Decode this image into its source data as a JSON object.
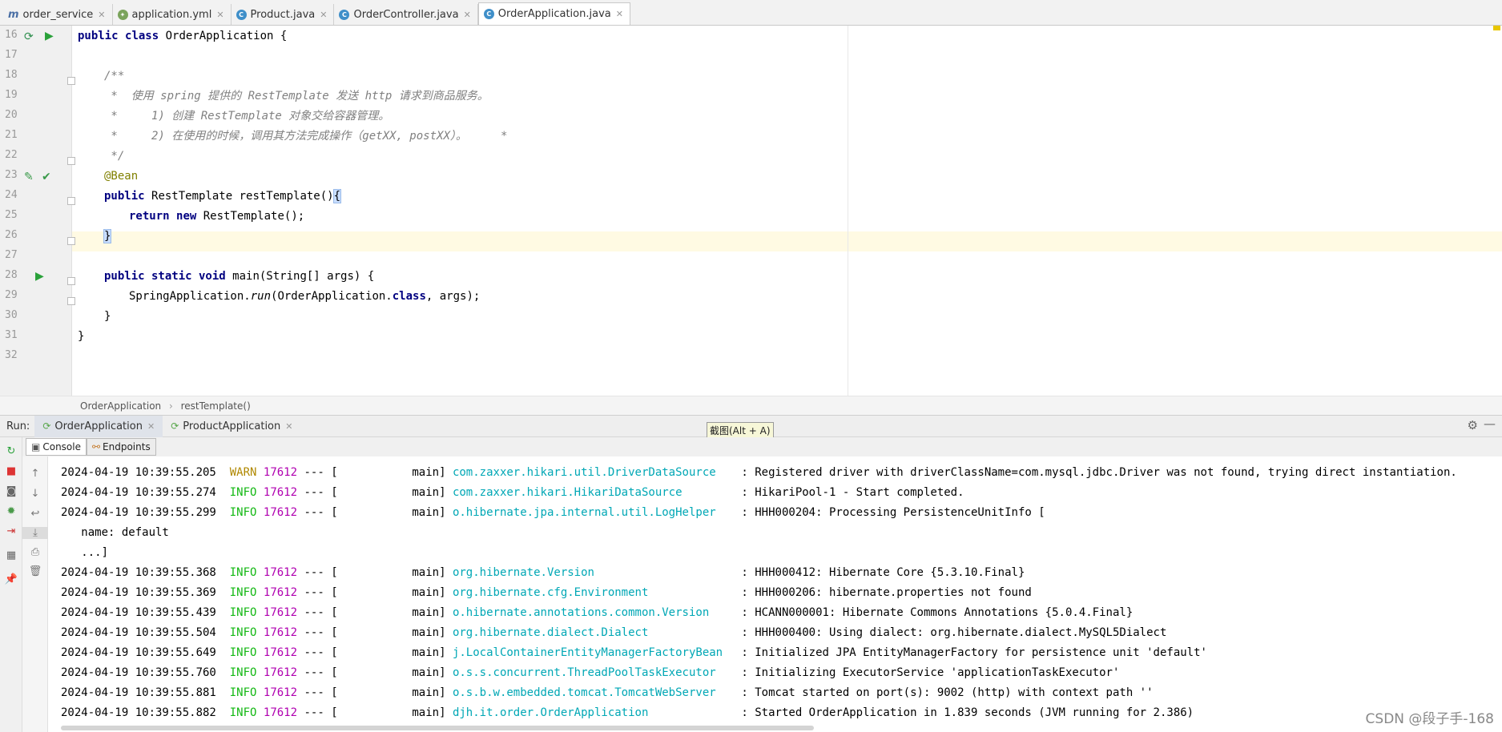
{
  "tabs": [
    {
      "label": "order_service",
      "icon": "module-icon",
      "active": false
    },
    {
      "label": "application.yml",
      "icon": "yaml-icon",
      "active": false
    },
    {
      "label": "Product.java",
      "icon": "class-icon",
      "active": false
    },
    {
      "label": "OrderController.java",
      "icon": "class-icon",
      "active": false
    },
    {
      "label": "OrderApplication.java",
      "icon": "class-icon",
      "active": true
    }
  ],
  "editor": {
    "line_numbers": [
      "16",
      "17",
      "18",
      "19",
      "20",
      "21",
      "22",
      "23",
      "24",
      "25",
      "26",
      "27",
      "28",
      "29",
      "30",
      "31",
      "32"
    ],
    "current_line": "26",
    "code": {
      "l16_kw1": "public",
      "l16_kw2": "class",
      "l16_rest": "OrderApplication {",
      "l18": "/**",
      "l19_a": " *  使用 ",
      "l19_b": "spring",
      "l19_c": " 提供的 ",
      "l19_d": "RestTemplate",
      "l19_e": " 发送 ",
      "l19_f": "http",
      "l19_g": " 请求到商品服务。",
      "l20_a": " *     1) 创建 ",
      "l20_b": "RestTemplate",
      "l20_c": " 对象交给容器管理。",
      "l21_a": " *     2) 在使用的时候，调用其方法完成操作（",
      "l21_b": "getXX, postXX",
      "l21_c": "）。     *",
      "l22": " */",
      "l23": "@Bean",
      "l24_kw": "public",
      "l24_rest": "RestTemplate restTemplate()",
      "l24_brace": "{",
      "l25_kw1": "return",
      "l25_kw2": "new",
      "l25_rest": "RestTemplate();",
      "l26": "}",
      "l28_kw": "public static void",
      "l28_rest": "main(String[] args) {",
      "l29_a": "SpringApplication.",
      "l29_b": "run",
      "l29_c": "(OrderApplication.",
      "l29_d": "class",
      "l29_e": ", args);",
      "l30": "}",
      "l31": "}"
    }
  },
  "breadcrumb": {
    "item1": "OrderApplication",
    "sep": "›",
    "item2": "restTemplate()"
  },
  "run": {
    "label": "Run:",
    "tabs": [
      {
        "label": "OrderApplication",
        "active": true
      },
      {
        "label": "ProductApplication",
        "active": false
      }
    ],
    "tooltip": "截图(Alt + A)"
  },
  "console_tabs": [
    {
      "label": "Console",
      "active": true
    },
    {
      "label": "Endpoints",
      "active": false
    }
  ],
  "log": [
    {
      "ts": "2024-04-19 10:39:55.205",
      "level": "WARN",
      "pid": "17612",
      "sep": "--- [",
      "thread": "main]",
      "logger": "com.zaxxer.hikari.util.DriverDataSource",
      "msg": ": Registered driver with driverClassName=com.mysql.jdbc.Driver was not found, trying direct instantiation."
    },
    {
      "ts": "2024-04-19 10:39:55.274",
      "level": "INFO",
      "pid": "17612",
      "sep": "--- [",
      "thread": "main]",
      "logger": "com.zaxxer.hikari.HikariDataSource",
      "msg": ": HikariPool-1 - Start completed."
    },
    {
      "ts": "2024-04-19 10:39:55.299",
      "level": "INFO",
      "pid": "17612",
      "sep": "--- [",
      "thread": "main]",
      "logger": "o.hibernate.jpa.internal.util.LogHelper",
      "msg": ": HHH000204: Processing PersistenceUnitInfo ["
    },
    {
      "plain": "   name: default"
    },
    {
      "plain": "   ...]"
    },
    {
      "ts": "2024-04-19 10:39:55.368",
      "level": "INFO",
      "pid": "17612",
      "sep": "--- [",
      "thread": "main]",
      "logger": "org.hibernate.Version",
      "msg": ": HHH000412: Hibernate Core {5.3.10.Final}"
    },
    {
      "ts": "2024-04-19 10:39:55.369",
      "level": "INFO",
      "pid": "17612",
      "sep": "--- [",
      "thread": "main]",
      "logger": "org.hibernate.cfg.Environment",
      "msg": ": HHH000206: hibernate.properties not found"
    },
    {
      "ts": "2024-04-19 10:39:55.439",
      "level": "INFO",
      "pid": "17612",
      "sep": "--- [",
      "thread": "main]",
      "logger": "o.hibernate.annotations.common.Version",
      "msg": ": HCANN000001: Hibernate Commons Annotations {5.0.4.Final}"
    },
    {
      "ts": "2024-04-19 10:39:55.504",
      "level": "INFO",
      "pid": "17612",
      "sep": "--- [",
      "thread": "main]",
      "logger": "org.hibernate.dialect.Dialect",
      "msg": ": HHH000400: Using dialect: org.hibernate.dialect.MySQL5Dialect"
    },
    {
      "ts": "2024-04-19 10:39:55.649",
      "level": "INFO",
      "pid": "17612",
      "sep": "--- [",
      "thread": "main]",
      "logger": "j.LocalContainerEntityManagerFactoryBean",
      "msg": ": Initialized JPA EntityManagerFactory for persistence unit 'default'"
    },
    {
      "ts": "2024-04-19 10:39:55.760",
      "level": "INFO",
      "pid": "17612",
      "sep": "--- [",
      "thread": "main]",
      "logger": "o.s.s.concurrent.ThreadPoolTaskExecutor",
      "msg": ": Initializing ExecutorService 'applicationTaskExecutor'"
    },
    {
      "ts": "2024-04-19 10:39:55.881",
      "level": "INFO",
      "pid": "17612",
      "sep": "--- [",
      "thread": "main]",
      "logger": "o.s.b.w.embedded.tomcat.TomcatWebServer",
      "msg": ": Tomcat started on port(s): 9002 (http) with context path ''"
    },
    {
      "ts": "2024-04-19 10:39:55.882",
      "level": "INFO",
      "pid": "17612",
      "sep": "--- [",
      "thread": "main]",
      "logger": "djh.it.order.OrderApplication",
      "msg": ": Started OrderApplication in 1.839 seconds (JVM running for 2.386)"
    }
  ],
  "watermark": "CSDN @段子手-168",
  "colors": {
    "warn": "#b08800",
    "info": "#13b813",
    "pid": "#b000b0",
    "logger": "#00a7b5",
    "keyword": "#000080",
    "comment": "#808080",
    "annotation": "#808000"
  }
}
